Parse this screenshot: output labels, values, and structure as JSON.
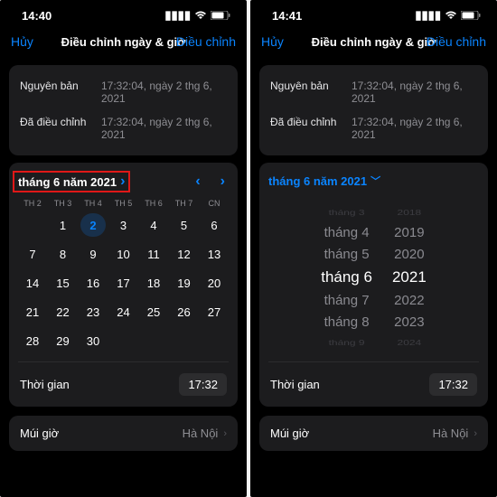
{
  "left": {
    "time": "14:40",
    "nav": {
      "cancel": "Hủy",
      "title": "Điều chỉnh ngày & giờ",
      "done": "Điều chỉnh"
    },
    "original_label": "Nguyên bản",
    "original_value": "17:32:04, ngày 2 thg 6, 2021",
    "adjusted_label": "Đã điều chỉnh",
    "adjusted_value": "17:32:04, ngày 2 thg 6, 2021",
    "month_year": "tháng 6 năm 2021",
    "weekdays": [
      "TH 2",
      "TH 3",
      "TH 4",
      "TH 5",
      "TH 6",
      "TH 7",
      "CN"
    ],
    "weeks": [
      [
        "",
        "1",
        "2",
        "3",
        "4",
        "5",
        "6"
      ],
      [
        "7",
        "8",
        "9",
        "10",
        "11",
        "12",
        "13"
      ],
      [
        "14",
        "15",
        "16",
        "17",
        "18",
        "19",
        "20"
      ],
      [
        "21",
        "22",
        "23",
        "24",
        "25",
        "26",
        "27"
      ],
      [
        "28",
        "29",
        "30",
        "",
        "",
        "",
        ""
      ]
    ],
    "selected_day": "2",
    "time_label": "Thời gian",
    "time_value": "17:32",
    "tz_label": "Múi giờ",
    "tz_value": "Hà Nội"
  },
  "right": {
    "time": "14:41",
    "nav": {
      "cancel": "Hủy",
      "title": "Điều chỉnh ngày & giờ",
      "done": "Điều chỉnh"
    },
    "original_label": "Nguyên bản",
    "original_value": "17:32:04, ngày 2 thg 6, 2021",
    "adjusted_label": "Đã điều chỉnh",
    "adjusted_value": "17:32:04, ngày 2 thg 6, 2021",
    "month_year": "tháng 6 năm 2021",
    "picker_months": [
      "tháng 3",
      "tháng 4",
      "tháng 5",
      "tháng 6",
      "tháng 7",
      "tháng 8",
      "tháng 9"
    ],
    "picker_years": [
      "2018",
      "2019",
      "2020",
      "2021",
      "2022",
      "2023",
      "2024"
    ],
    "time_label": "Thời gian",
    "time_value": "17:32",
    "tz_label": "Múi giờ",
    "tz_value": "Hà Nội"
  }
}
